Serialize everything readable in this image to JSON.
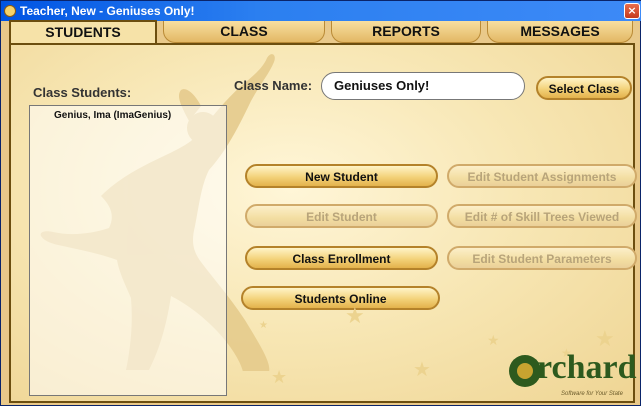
{
  "window": {
    "title": "Teacher, New - Geniuses Only!",
    "close_glyph": "×"
  },
  "tabs": [
    {
      "label": "STUDENTS",
      "active": true
    },
    {
      "label": "CLASS",
      "active": false
    },
    {
      "label": "REPORTS",
      "active": false
    },
    {
      "label": "MESSAGES",
      "active": false
    }
  ],
  "students_panel": {
    "label": "Class Students:",
    "items": [
      "Genius, Ima (ImaGenius)"
    ]
  },
  "class": {
    "label": "Class Name:",
    "value": "Geniuses Only!",
    "select_button": "Select Class"
  },
  "buttons": {
    "new_student": "New Student",
    "edit_assignments": "Edit Student Assignments",
    "edit_student": "Edit Student",
    "edit_skill_trees": "Edit # of Skill Trees Viewed",
    "class_enrollment": "Class Enrollment",
    "edit_parameters": "Edit Student Parameters",
    "students_online": "Students Online"
  },
  "logo": {
    "text": "rchard",
    "tagline": "Software for Your State"
  },
  "colors": {
    "titlebar": "#0054e3",
    "panel_bg": "#f7e6b3",
    "accent_border": "#6c4e0f",
    "logo_green": "#2d5a1e"
  },
  "icons": {
    "app": "orchard-app-icon",
    "close": "close-icon",
    "logo": "orchard-logo-icon"
  }
}
